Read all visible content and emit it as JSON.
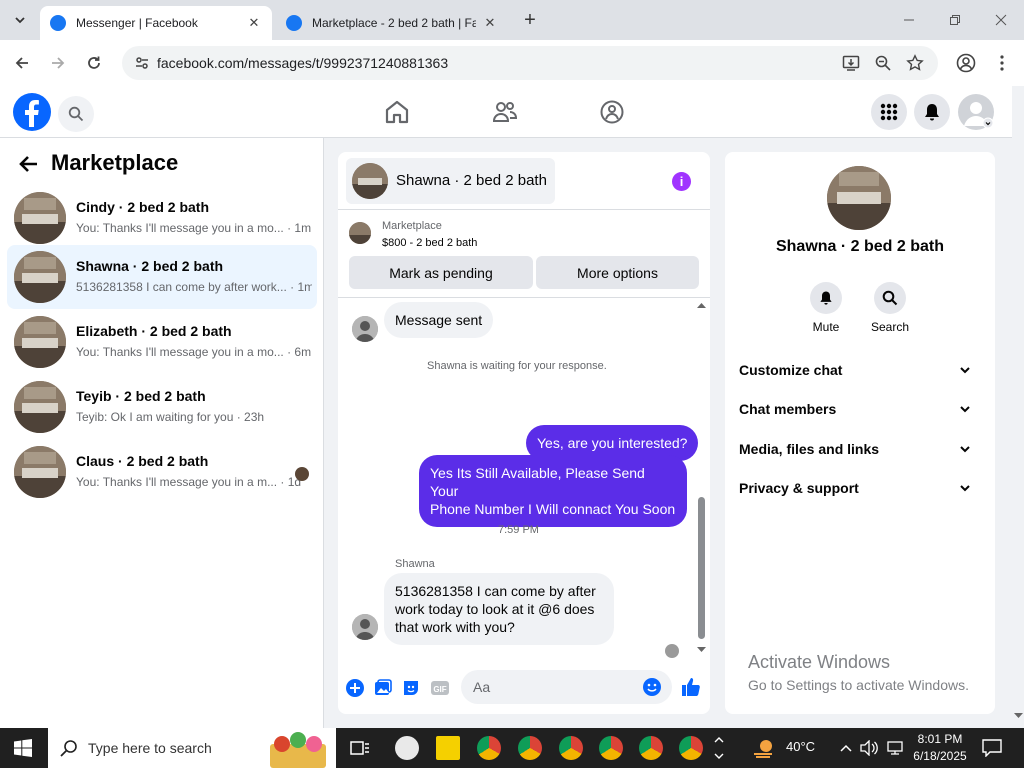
{
  "browser": {
    "tabs": [
      {
        "title": "Messenger | Facebook",
        "active": true
      },
      {
        "title": "Marketplace - 2 bed 2 bath | Fa",
        "active": false
      }
    ],
    "url": "facebook.com/messages/t/9992371240881363"
  },
  "left_panel": {
    "title": "Marketplace",
    "conversations": [
      {
        "name": "Cindy · 2 bed 2 bath",
        "snippet": "You: Thanks I'll message you in a mo... · 1m",
        "selected": false
      },
      {
        "name": "Shawna · 2 bed 2 bath",
        "snippet": "5136281358 I can come by after work... · 1m",
        "selected": true
      },
      {
        "name": "Elizabeth · 2 bed 2 bath",
        "snippet": "You: Thanks I'll message you in a mo... · 6m",
        "selected": false
      },
      {
        "name": "Teyib · 2 bed 2 bath",
        "snippet": "Teyib: Ok I am waiting for you · 23h",
        "selected": false
      },
      {
        "name": "Claus · 2 bed 2 bath",
        "snippet": "You: Thanks I'll message you in a m... · 1d",
        "selected": false
      }
    ]
  },
  "chat": {
    "header_title": "Shawna · 2 bed 2 bath",
    "listing": {
      "label": "Marketplace",
      "price_title": "$800 - 2 bed 2 bath"
    },
    "buttons": {
      "mark_pending": "Mark as pending",
      "more_options": "More options"
    },
    "messages": {
      "m1": "Message sent",
      "note": "Shawna is waiting for your response.",
      "out1": "Yes, are you interested?",
      "out2_line1": "Yes Its Still Available, Please Send Your",
      "out2_line2": "Phone Number I Will connact You Soon",
      "time": "7:59 PM",
      "sender": "Shawna",
      "in_line1": "5136281358 I can come by after",
      "in_line2": "work today to look at it @6 does",
      "in_line3": "that work with you?"
    },
    "composer_placeholder": "Aa"
  },
  "right_panel": {
    "name": "Shawna · 2 bed 2 bath",
    "actions": {
      "mute": "Mute",
      "search": "Search"
    },
    "sections": [
      "Customize chat",
      "Chat members",
      "Media, files and links",
      "Privacy & support"
    ]
  },
  "watermark": {
    "line1": "Activate Windows",
    "line2": "Go to Settings to activate Windows."
  },
  "taskbar": {
    "search_placeholder": "Type here to search",
    "temperature": "40°C",
    "time": "8:01 PM",
    "date": "6/18/2025"
  },
  "colors": {
    "accent": "#0866ff",
    "outgoing_bubble": "#5b2de8",
    "info": "#a033ff",
    "selected_row": "#ebf5ff"
  }
}
